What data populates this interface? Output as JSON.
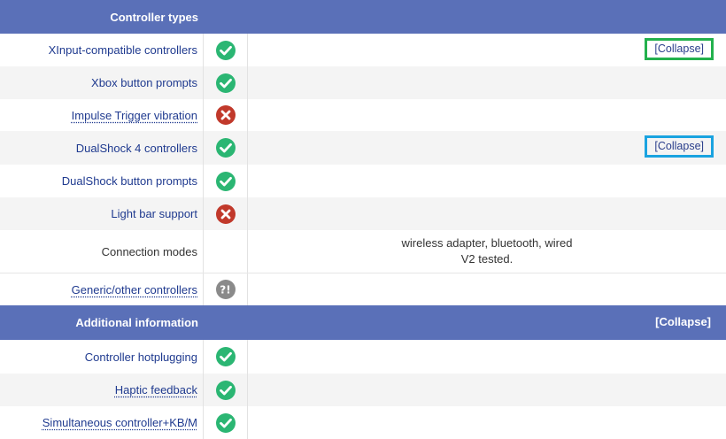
{
  "sections": {
    "controller_types": {
      "title": "Controller types",
      "rows": [
        {
          "label": "XInput-compatible controllers",
          "status": "yes",
          "collapse": "[Collapse]"
        },
        {
          "label": "Xbox button prompts",
          "status": "yes"
        },
        {
          "label": "Impulse Trigger vibration",
          "status": "no"
        },
        {
          "label": "DualShock 4 controllers",
          "status": "yes",
          "collapse": "[Collapse]"
        },
        {
          "label": "DualShock button prompts",
          "status": "yes"
        },
        {
          "label": "Light bar support",
          "status": "no"
        },
        {
          "label": "Connection modes",
          "note_line1": "wireless adapter, bluetooth, wired",
          "note_line2": "V2 tested."
        },
        {
          "label": "Generic/other controllers",
          "status": "unknown"
        }
      ]
    },
    "additional_information": {
      "title": "Additional information",
      "collapse": "[Collapse]",
      "rows": [
        {
          "label": "Controller hotplugging",
          "status": "yes"
        },
        {
          "label": "Haptic feedback",
          "status": "yes"
        },
        {
          "label": "Simultaneous controller+KB/M",
          "status": "yes"
        }
      ]
    }
  },
  "colors": {
    "header_bg": "#5a70b8",
    "check": "#2bb673",
    "cross": "#c1392b",
    "unknown": "#8a8a8a",
    "highlight_green": "#23b14d",
    "highlight_blue": "#1aa3e0"
  },
  "icons": {
    "yes": "check-circle-icon",
    "no": "cross-circle-icon",
    "unknown": "question-exclamation-icon"
  }
}
